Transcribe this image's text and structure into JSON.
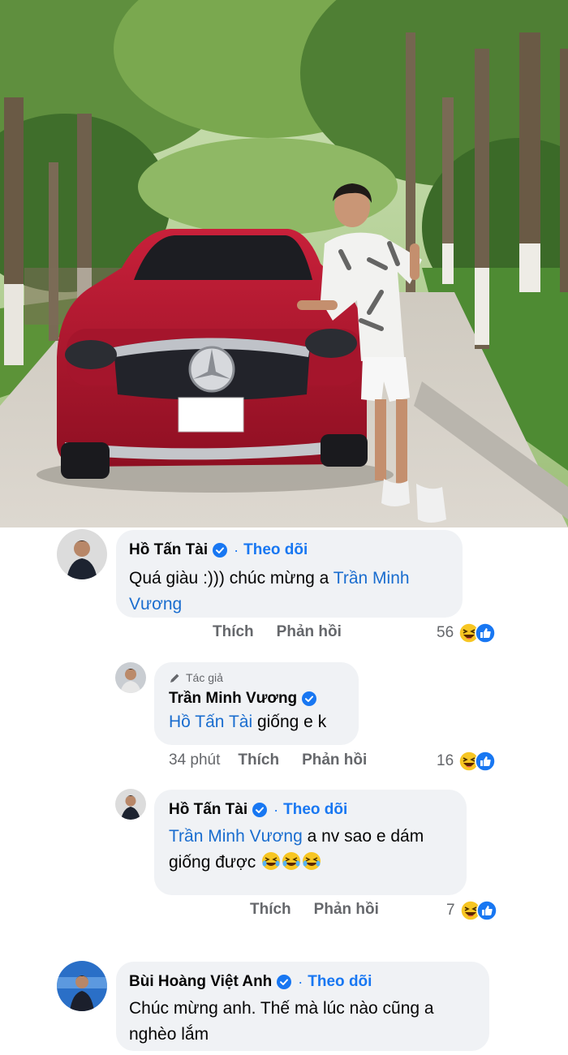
{
  "post": {
    "photo_description_icon": "car-photo",
    "colors": {
      "car": "#b5142b",
      "shirt": "#f3f3f3",
      "trees": "#3f7a2e",
      "road": "#d8d4ce"
    }
  },
  "comments": [
    {
      "author": "Hồ Tấn Tài",
      "verified": true,
      "follow_label": "Theo dõi",
      "text_plain": "Quá giàu :))) chúc mừng a ",
      "mention": "Trần Minh Vương",
      "actions": {
        "like": "Thích",
        "reply": "Phản hồi"
      },
      "reaction_count": "56"
    },
    {
      "author_badge": "Tác giả",
      "author": "Trần Minh Vương",
      "verified": true,
      "mention": "Hồ Tấn Tài",
      "text_plain": " giống e k",
      "actions": {
        "time": "34 phút",
        "like": "Thích",
        "reply": "Phản hồi"
      },
      "reaction_count": "16"
    },
    {
      "author": "Hồ Tấn Tài",
      "verified": true,
      "follow_label": "Theo dõi",
      "mention": "Trần Minh Vương",
      "text_plain_1": " a nv sao e dám",
      "text_plain_2": "giống được ",
      "emoji": "laughing-emoji x3",
      "actions": {
        "like": "Thích",
        "reply": "Phản hồi"
      },
      "reaction_count": "7"
    },
    {
      "author": "Bùi Hoàng Việt Anh",
      "verified": true,
      "follow_label": "Theo dõi",
      "text_line_1": "Chúc mừng anh. Thế mà lúc nào cũng a",
      "text_line_2": "nghèo lắm"
    }
  ],
  "separator_dot": "·",
  "colors": {
    "link": "#1877f2",
    "bubble": "#f0f2f5",
    "muted": "#65676b"
  }
}
